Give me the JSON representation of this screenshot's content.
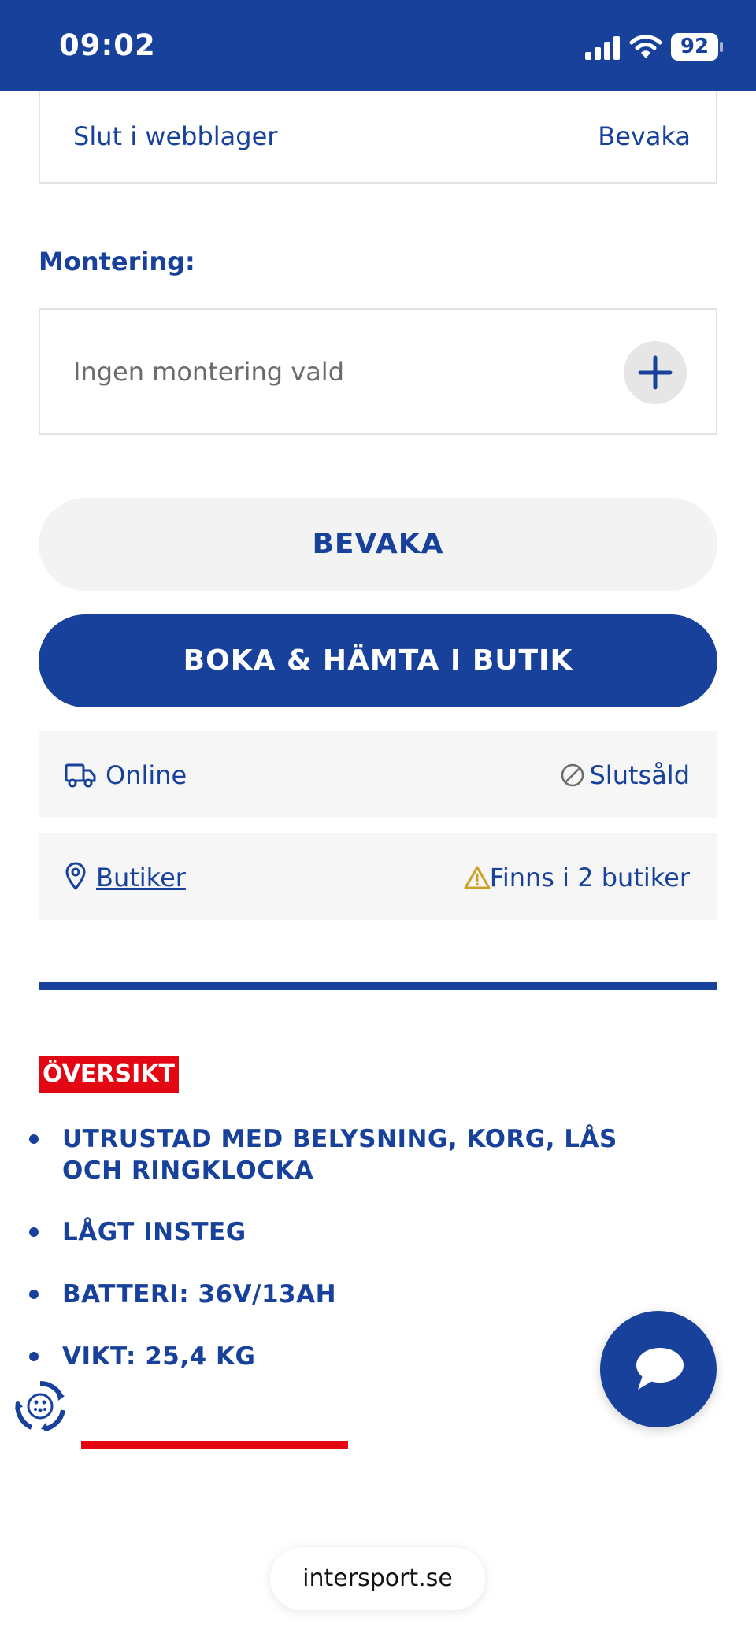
{
  "status_bar": {
    "time": "09:02",
    "battery": "92"
  },
  "stock": {
    "text": "Slut i webblager",
    "watch_link": "Bevaka"
  },
  "mounting": {
    "label": "Montering:",
    "placeholder": "Ingen montering vald"
  },
  "buttons": {
    "watch": "BEVAKA",
    "book": "BOKA & HÄMTA I BUTIK"
  },
  "availability": {
    "online": {
      "label": "Online",
      "status": "Slutsåld"
    },
    "stores": {
      "label": "Butiker",
      "status": "Finns i 2 butiker"
    }
  },
  "overview": {
    "heading": "ÖVERSIKT",
    "features": [
      "UTRUSTAD MED BELYSNING, KORG, LÅS OCH RINGKLOCKA",
      "LÅGT INSTEG",
      "BATTERI: 36V/13AH",
      "VIKT: 25,4 KG"
    ]
  },
  "browser": {
    "url": "intersport.se"
  },
  "icons": {
    "signal": "signal-icon",
    "wifi": "wifi-icon",
    "add": "plus-icon",
    "truck": "truck-icon",
    "ban": "ban-icon",
    "pin": "location-pin-icon",
    "warning": "warning-icon",
    "chat": "chat-bubble-icon",
    "accessibility": "accessibility-icon"
  },
  "colors": {
    "brand_blue": "#17419a",
    "brand_red": "#e30613",
    "warning": "#c9a227",
    "row_background": "#f6f6f6"
  }
}
